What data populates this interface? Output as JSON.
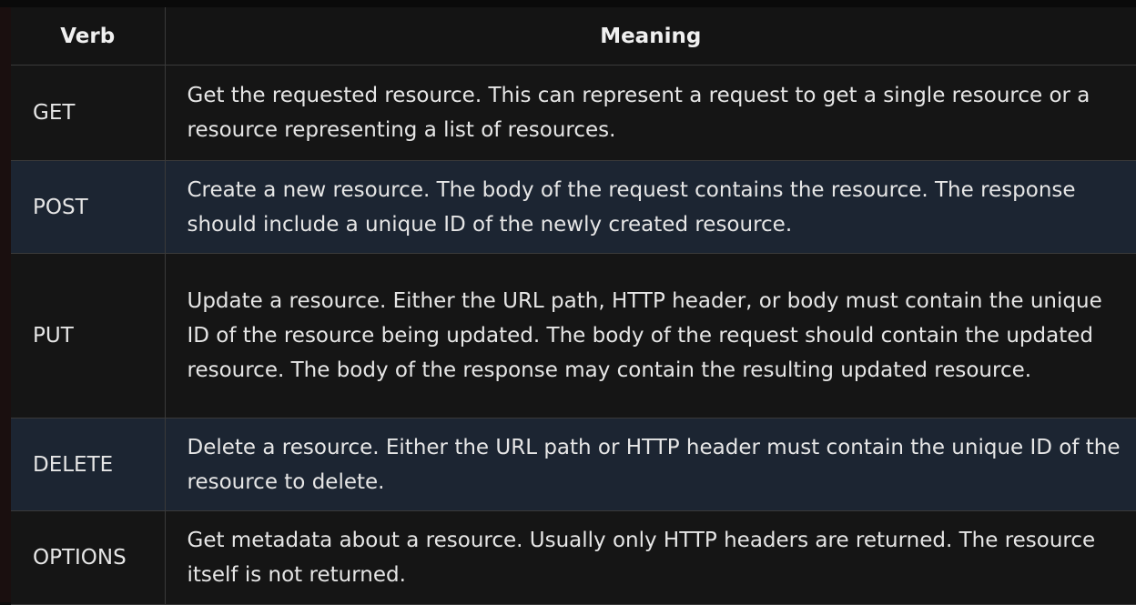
{
  "table": {
    "headers": [
      "Verb",
      "Meaning"
    ],
    "rows": [
      {
        "verb": "GET",
        "meaning": "Get the requested resource. This can represent a request to get a single resource or a resource representing a list of resources."
      },
      {
        "verb": "POST",
        "meaning": "Create a new resource. The body of the request contains the resource. The response should include a unique ID of the newly created resource."
      },
      {
        "verb": "PUT",
        "meaning": "Update a resource. Either the URL path, HTTP header, or body must contain the unique ID of the resource being updated. The body of the request should contain the updated resource. The body of the response may contain the resulting updated resource."
      },
      {
        "verb": "DELETE",
        "meaning": "Delete a resource. Either the URL path or HTTP header must contain the unique ID of the resource to delete."
      },
      {
        "verb": "OPTIONS",
        "meaning": "Get metadata about a resource. Usually only HTTP headers are returned. The resource itself is not returned."
      }
    ]
  }
}
